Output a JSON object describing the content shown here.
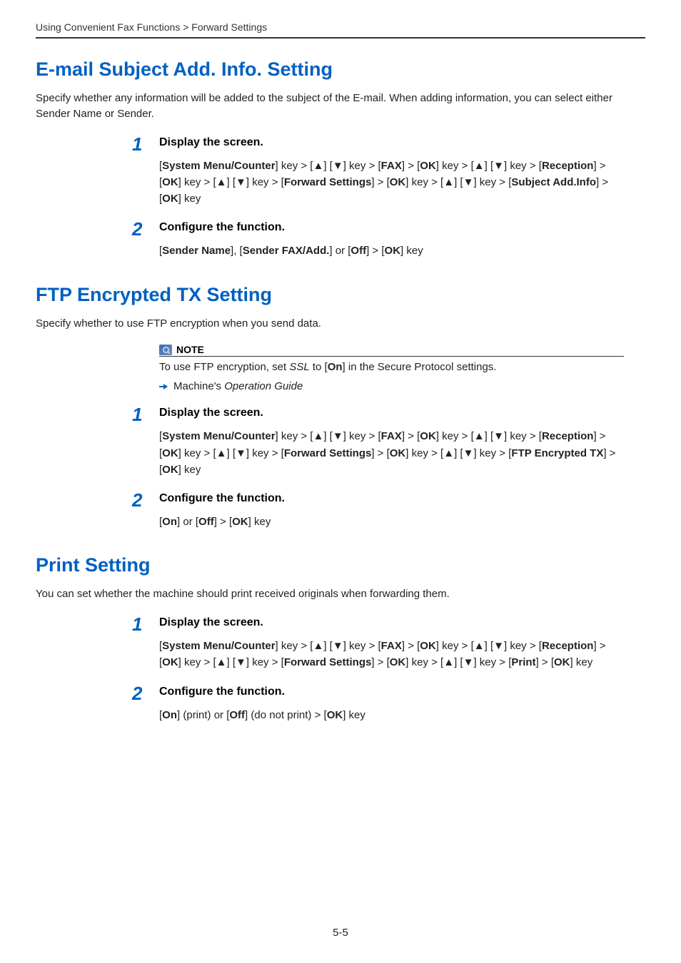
{
  "breadcrumb": "Using Convenient Fax Functions > Forward Settings",
  "sections": [
    {
      "title": "E-mail Subject Add. Info. Setting",
      "intro": "Specify whether any information will be added to the subject of the E-mail. When adding information, you can select either Sender Name or Sender.",
      "steps": [
        {
          "num": "1",
          "title": "Display the screen.",
          "body_html": "[<b>System Menu/Counter</b>] key > [<span class='tri'>▲</span>] [<span class='tri'>▼</span>] key > [<b>FAX</b>] > [<b>OK</b>] key > [<span class='tri'>▲</span>] [<span class='tri'>▼</span>] key > [<b>Reception</b>] > [<b>OK</b>] key > [<span class='tri'>▲</span>] [<span class='tri'>▼</span>] key > [<b>Forward Settings</b>] > [<b>OK</b>] key > [<span class='tri'>▲</span>] [<span class='tri'>▼</span>] key > [<b>Subject Add.Info</b>] > [<b>OK</b>] key"
        },
        {
          "num": "2",
          "title": "Configure the function.",
          "body_html": "[<b>Sender Name</b>], [<b>Sender FAX/Add.</b>] or [<b>Off</b>] > [<b>OK</b>] key"
        }
      ]
    },
    {
      "title": "FTP Encrypted TX Setting",
      "intro": "Specify whether to use FTP encryption when you send data.",
      "note": {
        "label": "NOTE",
        "text_html": "To use FTP encryption, set <i>SSL</i> to [<b>On</b>] in the Secure Protocol settings.",
        "xref_html": "Machine's <i>Operation Guide</i>"
      },
      "steps": [
        {
          "num": "1",
          "title": "Display the screen.",
          "body_html": "[<b>System Menu/Counter</b>] key > [<span class='tri'>▲</span>] [<span class='tri'>▼</span>] key > [<b>FAX</b>] > [<b>OK</b>] key > [<span class='tri'>▲</span>] [<span class='tri'>▼</span>] key > [<b>Reception</b>] > [<b>OK</b>] key > [<span class='tri'>▲</span>] [<span class='tri'>▼</span>] key > [<b>Forward Settings</b>] > [<b>OK</b>] key > [<span class='tri'>▲</span>] [<span class='tri'>▼</span>] key > [<b>FTP Encrypted TX</b>] > [<b>OK</b>] key"
        },
        {
          "num": "2",
          "title": "Configure the function.",
          "body_html": "[<b>On</b>] or [<b>Off</b>] > [<b>OK</b>] key"
        }
      ]
    },
    {
      "title": "Print Setting",
      "intro": "You can set whether the machine should print received originals when forwarding them.",
      "steps": [
        {
          "num": "1",
          "title": "Display the screen.",
          "body_html": "[<b>System Menu/Counter</b>] key > [<span class='tri'>▲</span>] [<span class='tri'>▼</span>] key > [<b>FAX</b>] > [<b>OK</b>] key > [<span class='tri'>▲</span>] [<span class='tri'>▼</span>] key > [<b>Reception</b>] > [<b>OK</b>] key > [<span class='tri'>▲</span>] [<span class='tri'>▼</span>] key > [<b>Forward Settings</b>] > [<b>OK</b>] key > [<span class='tri'>▲</span>] [<span class='tri'>▼</span>] key > [<b>Print</b>] > [<b>OK</b>] key"
        },
        {
          "num": "2",
          "title": "Configure the function.",
          "body_html": "[<b>On</b>] (print) or [<b>Off</b>] (do not print) > [<b>OK</b>] key"
        }
      ]
    }
  ],
  "page_number": "5-5"
}
